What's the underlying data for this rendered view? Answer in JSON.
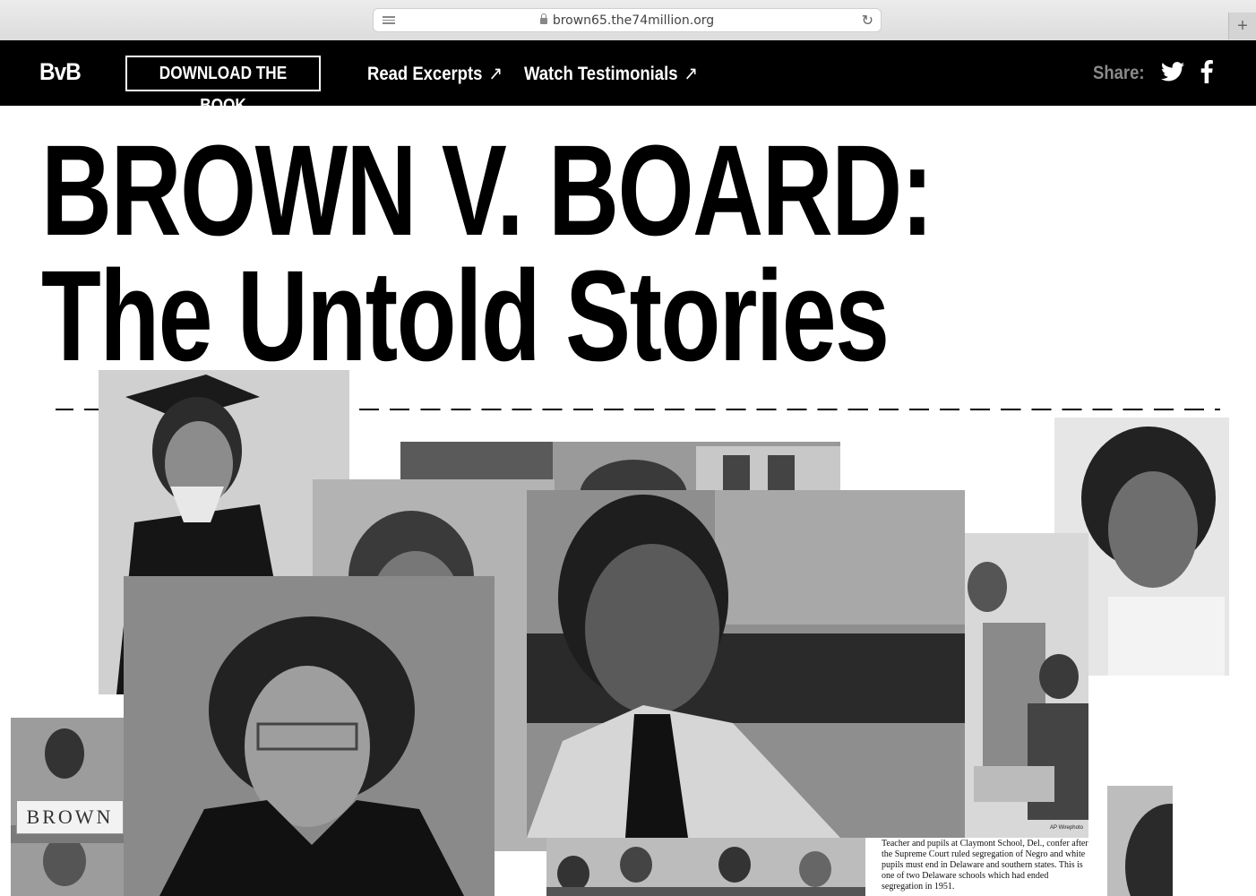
{
  "browser": {
    "url": "brown65.the74million.org",
    "new_tab": "+"
  },
  "nav": {
    "logo": "BvB",
    "download_label": "DOWNLOAD THE BOOK",
    "links": [
      {
        "label": "Read Excerpts",
        "arrow": "↗"
      },
      {
        "label": "Watch Testimonials",
        "arrow": "↗"
      }
    ],
    "share_label": "Share:",
    "share_icons": [
      "twitter-icon",
      "facebook-icon"
    ]
  },
  "hero": {
    "title_line1": "BROWN V. BOARD:",
    "title_line2": "The Untold Stories"
  },
  "collage": {
    "sign_text": "BROWN",
    "ap_credit": "AP Wirephoto",
    "caption": "Teacher and pupils at Claymont School, Del., confer after the Supreme Court ruled segregation of Negro and white pupils must end in Delaware and southern states. This is one of two Delaware schools which had ended segregation in 1951."
  },
  "colors": {
    "nav_bg": "#000000",
    "nav_text": "#ffffff",
    "share_text": "#8a8a8a",
    "page_bg": "#ffffff"
  }
}
